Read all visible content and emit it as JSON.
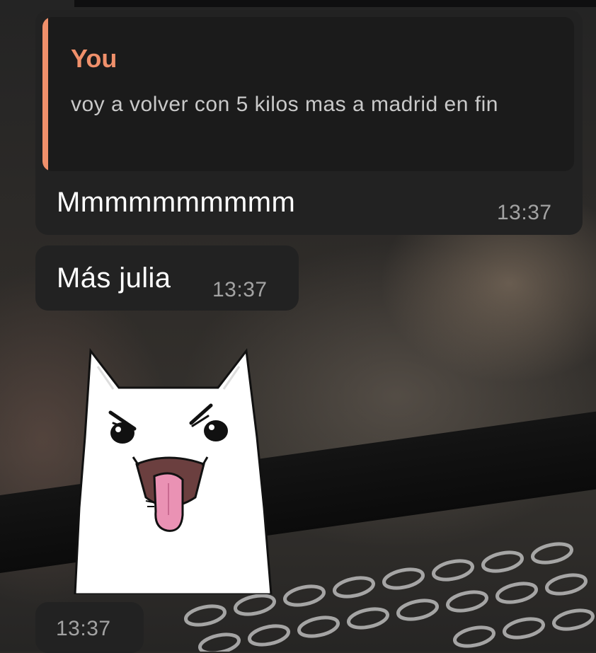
{
  "messages": [
    {
      "reply": {
        "author": "You",
        "text": "voy a volver con 5 kilos mas a madrid en fin"
      },
      "text": "Mmmmmmmmmm",
      "time": "13:37"
    },
    {
      "text": "Más julia",
      "time": "13:37"
    },
    {
      "sticker": "white-cat-tongue-sticker",
      "time": "13:37"
    }
  ],
  "colors": {
    "bubble": "#222222",
    "reply_background": "#1b1b1b",
    "reply_accent": "#f0906b",
    "timestamp": "#a3a3a3",
    "text": "#ffffff"
  }
}
